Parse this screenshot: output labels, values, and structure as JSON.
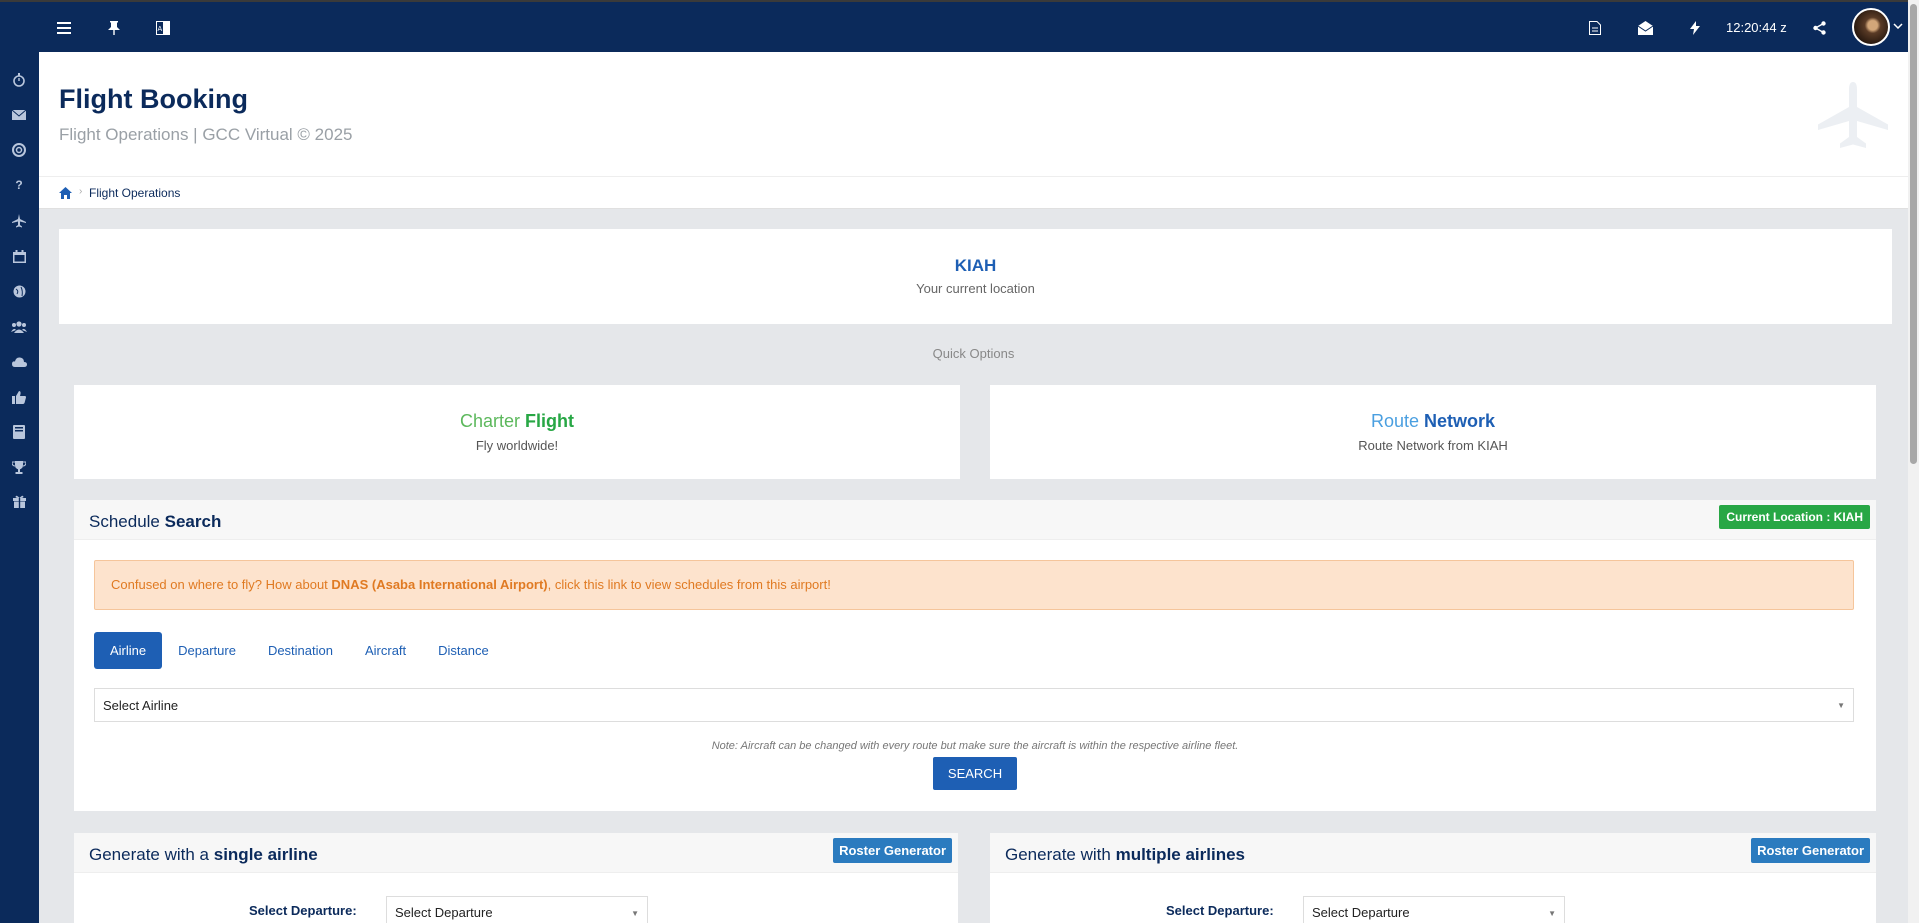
{
  "topbar": {
    "clock": "12:20:44 z",
    "icons": [
      "menu-icon",
      "pin-icon",
      "translate-icon",
      "document-icon",
      "envelope-open-icon",
      "bolt-icon",
      "share-icon"
    ]
  },
  "sidebar": {
    "icons": [
      "bolt-icon",
      "stopwatch-icon",
      "envelope-icon",
      "lifebuoy-icon",
      "question-icon",
      "plane-icon",
      "calendar-icon",
      "globe-icon",
      "users-icon",
      "cloud-icon",
      "thumbs-up-icon",
      "book-icon",
      "trophy-icon",
      "gift-icon"
    ]
  },
  "header": {
    "title": "Flight Booking",
    "subtitle": "Flight Operations | GCC Virtual © 2025"
  },
  "breadcrumb": {
    "current": "Flight Operations"
  },
  "location": {
    "code": "KIAH",
    "label": "Your current location"
  },
  "quick_options": {
    "title": "Quick Options",
    "charter": {
      "light": "Charter",
      "bold": "Flight",
      "subtitle": "Fly worldwide!"
    },
    "route": {
      "light": "Route",
      "bold": "Network",
      "subtitle": "Route Network from KIAH"
    }
  },
  "schedule_search": {
    "title_light": "Schedule",
    "title_bold": "Search",
    "badge": "Current Location : KIAH",
    "alert_prefix": "Confused on where to fly? How about ",
    "alert_link": "DNAS (Asaba International Airport)",
    "alert_suffix": ", click this link to view schedules from this airport!",
    "tabs": [
      "Airline",
      "Departure",
      "Destination",
      "Aircraft",
      "Distance"
    ],
    "select_value": "Select Airline",
    "note": "Note: Aircraft can be changed with every route but make sure the aircraft is within the respective airline fleet.",
    "search_label": "SEARCH"
  },
  "single_airline": {
    "title_light": "Generate with a",
    "title_bold": "single airline",
    "badge": "Roster Generator",
    "departure_label": "Select Departure:",
    "departure_value": "Select Departure"
  },
  "multiple_airlines": {
    "title_light": "Generate with",
    "title_bold": "multiple airlines",
    "badge": "Roster Generator",
    "departure_label": "Select Departure:",
    "departure_value": "Select Departure"
  }
}
